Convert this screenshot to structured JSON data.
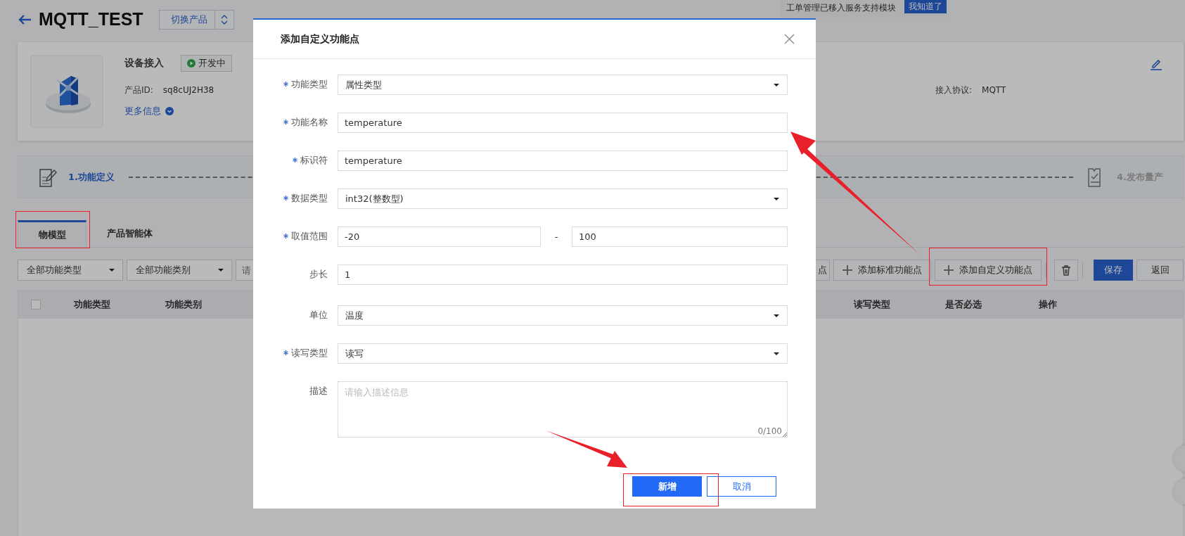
{
  "notice": {
    "text": "工单管理已移入服务支持模块",
    "button": "我知道了"
  },
  "header": {
    "title": "MQTT_TEST",
    "switch_button": "切换产品"
  },
  "product": {
    "name": "设备接入",
    "status": "开发中",
    "id_label": "产品ID:",
    "id": "sq8cUJ2H38",
    "more": "更多信息",
    "protocol_label": "接入协议:",
    "protocol": "MQTT"
  },
  "steps": [
    {
      "label": "1.功能定义",
      "selected": true
    },
    {
      "label": "4.发布量产",
      "selected": false
    }
  ],
  "tabs": [
    {
      "label": "物模型",
      "selected": true
    },
    {
      "label": "产品智能体",
      "selected": false
    }
  ],
  "filters": [
    {
      "kind": "select",
      "value": "全部功能类型"
    },
    {
      "kind": "select",
      "value": "全部功能类别"
    },
    {
      "kind": "search",
      "placeholder": "请"
    }
  ],
  "toolbar": [
    {
      "kind": "plain",
      "label": "点"
    },
    {
      "kind": "add",
      "label": "添加标准功能点"
    },
    {
      "kind": "add",
      "label": "添加自定义功能点"
    },
    {
      "kind": "delete"
    },
    {
      "kind": "primary",
      "label": "保存"
    },
    {
      "kind": "default",
      "label": "返回"
    }
  ],
  "table": {
    "select_all": {
      "checked": false
    },
    "columns": [
      "功能类型",
      "功能类别",
      "读写类型",
      "是否必选",
      "操作"
    ]
  },
  "modal": {
    "title": "添加自定义功能点",
    "fields": [
      {
        "label": "功能类型",
        "required": true,
        "kind": "select",
        "value": "属性类型"
      },
      {
        "label": "功能名称",
        "required": true,
        "kind": "input",
        "value": "temperature"
      },
      {
        "label": "标识符",
        "required": true,
        "kind": "input",
        "value": "temperature"
      },
      {
        "label": "数据类型",
        "required": true,
        "kind": "select",
        "value": "int32(整数型)"
      },
      {
        "label": "取值范围",
        "required": true,
        "kind": "range",
        "min": "-20",
        "separator": "-",
        "max": "100"
      },
      {
        "label": "步长",
        "required": false,
        "kind": "input",
        "value": "1"
      },
      {
        "label": "单位",
        "required": false,
        "kind": "select",
        "value": "温度"
      },
      {
        "label": "读写类型",
        "required": true,
        "kind": "select",
        "value": "读写"
      },
      {
        "label": "描述",
        "required": false,
        "kind": "textarea",
        "placeholder": "请输入描述信息",
        "counter": "0/100"
      }
    ],
    "buttons": [
      {
        "kind": "primary",
        "label": "新增"
      },
      {
        "kind": "secondary",
        "label": "取消"
      }
    ]
  }
}
